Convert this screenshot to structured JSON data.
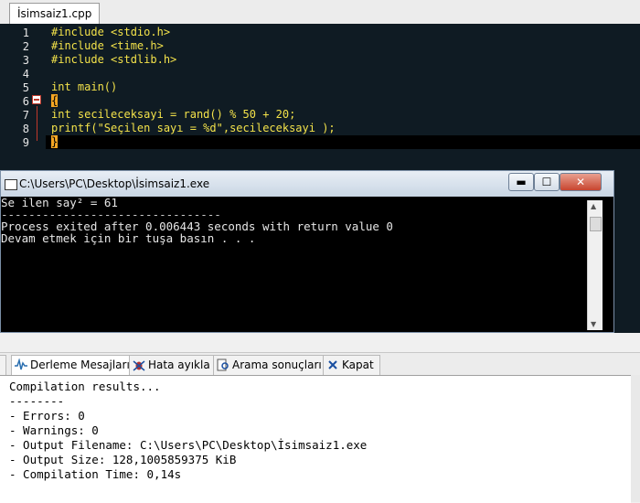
{
  "editor": {
    "tab_label": "İsimsaiz1.cpp",
    "line_numbers": [
      "1",
      "2",
      "3",
      "4",
      "5",
      "6",
      "7",
      "8",
      "9"
    ],
    "lines": [
      {
        "t": "#include <stdio.h>"
      },
      {
        "t": "#include <time.h>"
      },
      {
        "t": "#include <stdlib.h>"
      },
      {
        "t": ""
      },
      {
        "t": "int main()"
      },
      {
        "t": "{"
      },
      {
        "t": "int secileceksayi = rand() % 50 + 20;"
      },
      {
        "t": "printf(\"Seçilen sayı = %d\",secileceksayi );"
      },
      {
        "t": "}"
      }
    ]
  },
  "console": {
    "title": "C:\\Users\\PC\\Desktop\\İsimsaiz1.exe",
    "min_label": "▬",
    "max_label": "☐",
    "close_label": "✕",
    "lines": [
      "Se ilen say² = 61",
      "--------------------------------",
      "Process exited after 0.006443 seconds with return value 0",
      "Devam etmek için bir tuşa basın . . ."
    ]
  },
  "panel": {
    "tabs": [
      {
        "label": "r",
        "icon": "none"
      },
      {
        "label": "Derleme Mesajları",
        "icon": "waveform-icon"
      },
      {
        "label": "Hata ayıkla",
        "icon": "bug-icon"
      },
      {
        "label": "Arama sonuçları",
        "icon": "search-doc-icon"
      },
      {
        "label": "Kapat",
        "icon": "close-x-icon"
      }
    ]
  },
  "log": {
    "lines": [
      "Compilation results...",
      "--------",
      "- Errors: 0",
      "- Warnings: 0",
      "- Output Filename: C:\\Users\\PC\\Desktop\\İsimsaiz1.exe",
      "- Output Size: 128,1005859375 KiB",
      "- Compilation Time: 0,14s"
    ]
  }
}
